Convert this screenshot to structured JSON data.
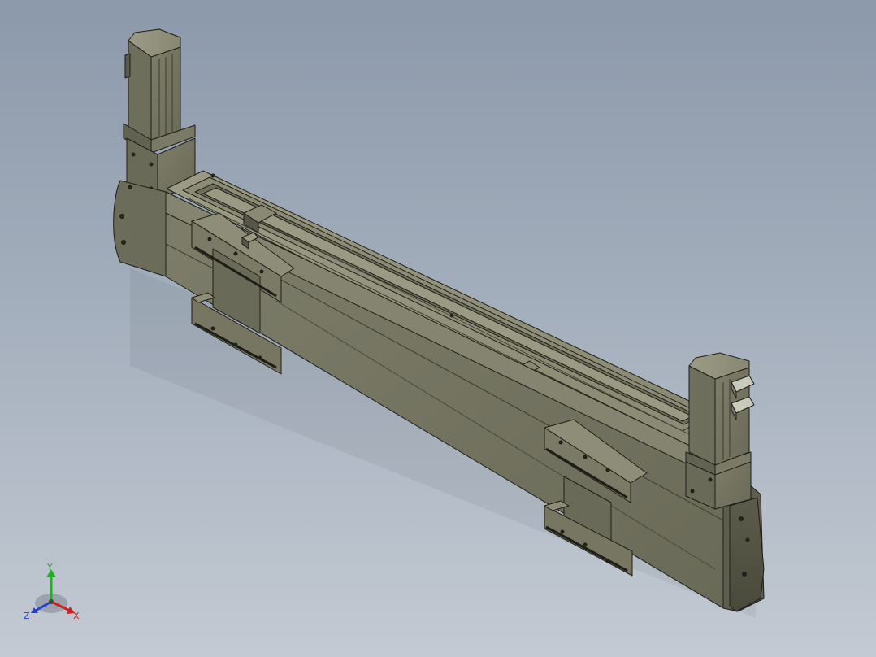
{
  "viewport": {
    "background_top": "#8c99aa",
    "background_bottom": "#c3cad3",
    "part_color": "#747462",
    "edge_color": "#1e1e16"
  },
  "triad": {
    "icon": "coordinate-triad-icon",
    "x_label": "X",
    "y_label": "Y",
    "z_label": "Z",
    "x_color": "#d0201e",
    "y_color": "#22b022",
    "z_color": "#2340cf"
  }
}
